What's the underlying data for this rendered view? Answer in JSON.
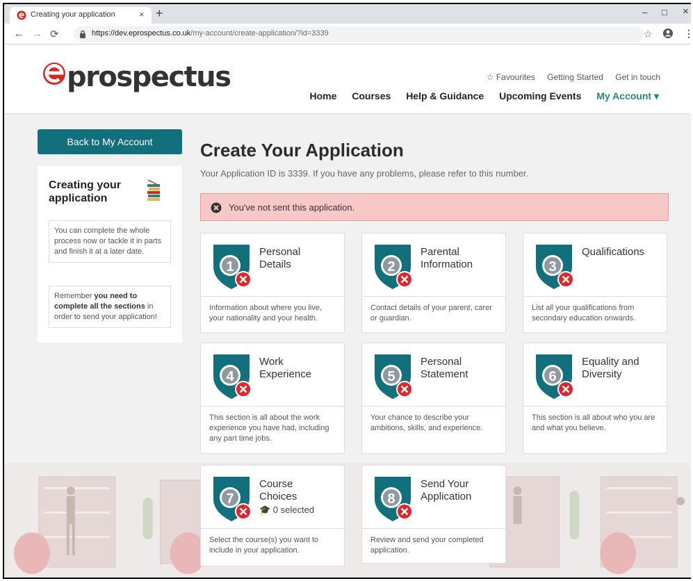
{
  "browser": {
    "tab_title": "Creating your application",
    "new_tab": "+",
    "url_host": "https://dev.eprospectus.co.uk",
    "url_path": "/my-account/create-application/?id=3339",
    "min": "–",
    "max": "□",
    "close": "×"
  },
  "header": {
    "logo_text": "prospectus",
    "util_links": {
      "favourites": "☆ Favourites",
      "getting_started": "Getting Started",
      "get_in_touch": "Get in touch"
    },
    "nav": {
      "home": "Home",
      "courses": "Courses",
      "help": "Help & Guidance",
      "events": "Upcoming Events",
      "account": "My Account ▾"
    }
  },
  "sidebar": {
    "back_label": "Back to My Account",
    "title": "Creating your application",
    "tip1": "You can complete the whole process now or tackle it in parts and finish it at a later date.",
    "tip2_pre": "Remember ",
    "tip2_bold": "you need to complete all the sections",
    "tip2_post": " in order to send your application!"
  },
  "main": {
    "title": "Create Your Application",
    "subtitle": "Your Application ID is 3339. If you have any problems, please refer to this number.",
    "alert": "You've not sent this application.",
    "colors": {
      "accent": "#1f8a80",
      "badge": "#12707c",
      "error": "#e3242b"
    },
    "cards": [
      {
        "num": "1",
        "title1": "Personal",
        "title2": "Details",
        "desc": "Information about where you live, your nationality and your health."
      },
      {
        "num": "2",
        "title1": "Parental",
        "title2": "Information",
        "desc": "Contact details of your parent, carer or guardian."
      },
      {
        "num": "3",
        "title1": "Qualifications",
        "title2": "",
        "desc": "List all your qualifications from secondary education onwards."
      },
      {
        "num": "4",
        "title1": "Work",
        "title2": "Experience",
        "desc": "This section is all about the work experience you have had, including any part time jobs."
      },
      {
        "num": "5",
        "title1": "Personal",
        "title2": "Statement",
        "desc": "Your chance to describe your ambitions, skills, and experience."
      },
      {
        "num": "6",
        "title1": "Equality and",
        "title2": "Diversity",
        "desc": "This section is all about who you are and what you believe."
      },
      {
        "num": "7",
        "title1": "Course",
        "title2": "Choices",
        "desc": "Select the course(s) you want to include in your application.",
        "selected": "0 selected"
      },
      {
        "num": "8",
        "title1": "Send Your",
        "title2": "Application",
        "desc": "Review and send your completed application."
      }
    ]
  }
}
